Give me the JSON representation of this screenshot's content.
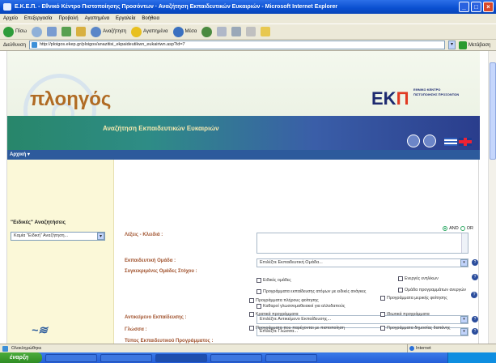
{
  "window": {
    "title": "Ε.Κ.Ε.Π. - Εθνικό Κέντρο Πιστοποίησης Προσόντων · Αναζήτηση Εκπαιδευτικών Ευκαιριών - Microsoft Internet Explorer",
    "buttons": [
      "_",
      "□",
      "×"
    ]
  },
  "menubar": [
    "Αρχείο",
    "Επεξεργασία",
    "Προβολή",
    "Αγαπημένα",
    "Εργαλεία",
    "Βοήθεια"
  ],
  "toolbar": {
    "back": "Πίσω",
    "search": "Αναζήτηση",
    "favorites": "Αγαπημένα",
    "media": "Μέσα"
  },
  "address": {
    "label": "Διεύθυνση",
    "url": "http://ploigos.ekep.gr/ploigos/anazitisi_ekpaideutikwn_eukairiwn.asp?id=7",
    "go": "Μετάβαση"
  },
  "site": {
    "logo": "πλοηγός",
    "ekep_mark_left": "ΕΚ",
    "ekep_mark_right": "Π",
    "ekep_text": "ΕΘΝΙΚΟ ΚΕΝΤΡΟ ΠΙΣΤΟΠΟΙΗΣΗΣ ΠΡΟΣΟΝΤΩΝ",
    "banner_title": "Αναζήτηση Εκπαιδευτικών Ευκαιριών",
    "home": "Αρχική ▾",
    "sidebar_title": "\"Ειδικές\" Αναζητήσεις",
    "sidebar_select": "Καμία \"Ειδική\" Αναζήτηση..."
  },
  "form": {
    "radio_and": "AND",
    "radio_or": "OR",
    "keywords_label": "Λέξεις - Κλειδιά :",
    "edu_group_label": "Εκπαιδευτική Ομάδα :",
    "edu_group_value": "Επιλέξτε Εκπαιδευτική Ομάδα...",
    "special_groups_label": "Συγκεκριμένες Ομάδες Στόχου :",
    "special_groups": [
      "Ειδικές ομάδες",
      "Ενεργές ενηλίκων",
      "Προγράμματα εκπαίδευσης ατόμων με ειδικές ανάγκες",
      "Ομάδα προγραμμάτων ανεργών",
      "Καθαροί γλωσσομαθειακοί για αλλοδαπούς"
    ],
    "level_label": "Αντικείμενο Εκπαίδευσης :",
    "level_value": "Επιλέξτε Αντικείμενο Εκπαίδευσης...",
    "region_label": "Γλώσσα :",
    "region_value": "Επιλέξτε Γλώσσα...",
    "program_type_label": "Τύπος Εκπαιδευτικού Προγράμματος :",
    "program_types": [
      "Προγράμματα πλήρους φοίτησης",
      "Προγράμματα μερικής φοίτησης",
      "Κρατικά προγράμματα",
      "Ιδιωτικά προγράμματα",
      "Προγράμματα που παρέχονται με πιστοποίηση",
      "Προγράμματα δημοσίας δαπάνης"
    ]
  },
  "status": {
    "left": "Ολοκληρώθηκε",
    "zone": "Internet"
  },
  "taskbar": {
    "start": "έναρξη"
  }
}
